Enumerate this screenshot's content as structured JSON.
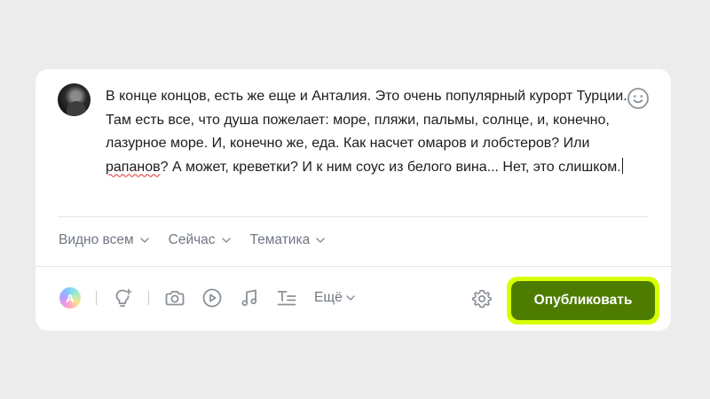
{
  "post": {
    "text_before": "В конце концов, есть же еще и Анталия. Это очень популярный курорт Турции. Там есть все, что душа пожелает: море, пляжи, пальмы, солнце, и, конечно, лазурное море. И, конечно же, еда. Как насчет омаров и лобстеров? Или ",
    "misspelled_word": "рапанов",
    "text_after": "? А может, креветки? И к ним соус из белого вина... Нет, это слишком."
  },
  "options": {
    "visibility": "Видно всем",
    "time": "Сейчас",
    "topic": "Тематика"
  },
  "toolbar": {
    "ai_letter": "A",
    "more_label": "Ещё",
    "icons": [
      "ai-assistant-icon",
      "lightbulb-icon",
      "camera-icon",
      "play-icon",
      "music-note-icon",
      "text-format-icon"
    ]
  },
  "publish_label": "Опубликовать",
  "colors": {
    "page_bg": "#ececec",
    "card_bg": "#ffffff",
    "publish_bg": "#4e7c00",
    "publish_highlight": "#d8ff00",
    "muted_text": "#6f7782",
    "icon": "#8a9199"
  }
}
